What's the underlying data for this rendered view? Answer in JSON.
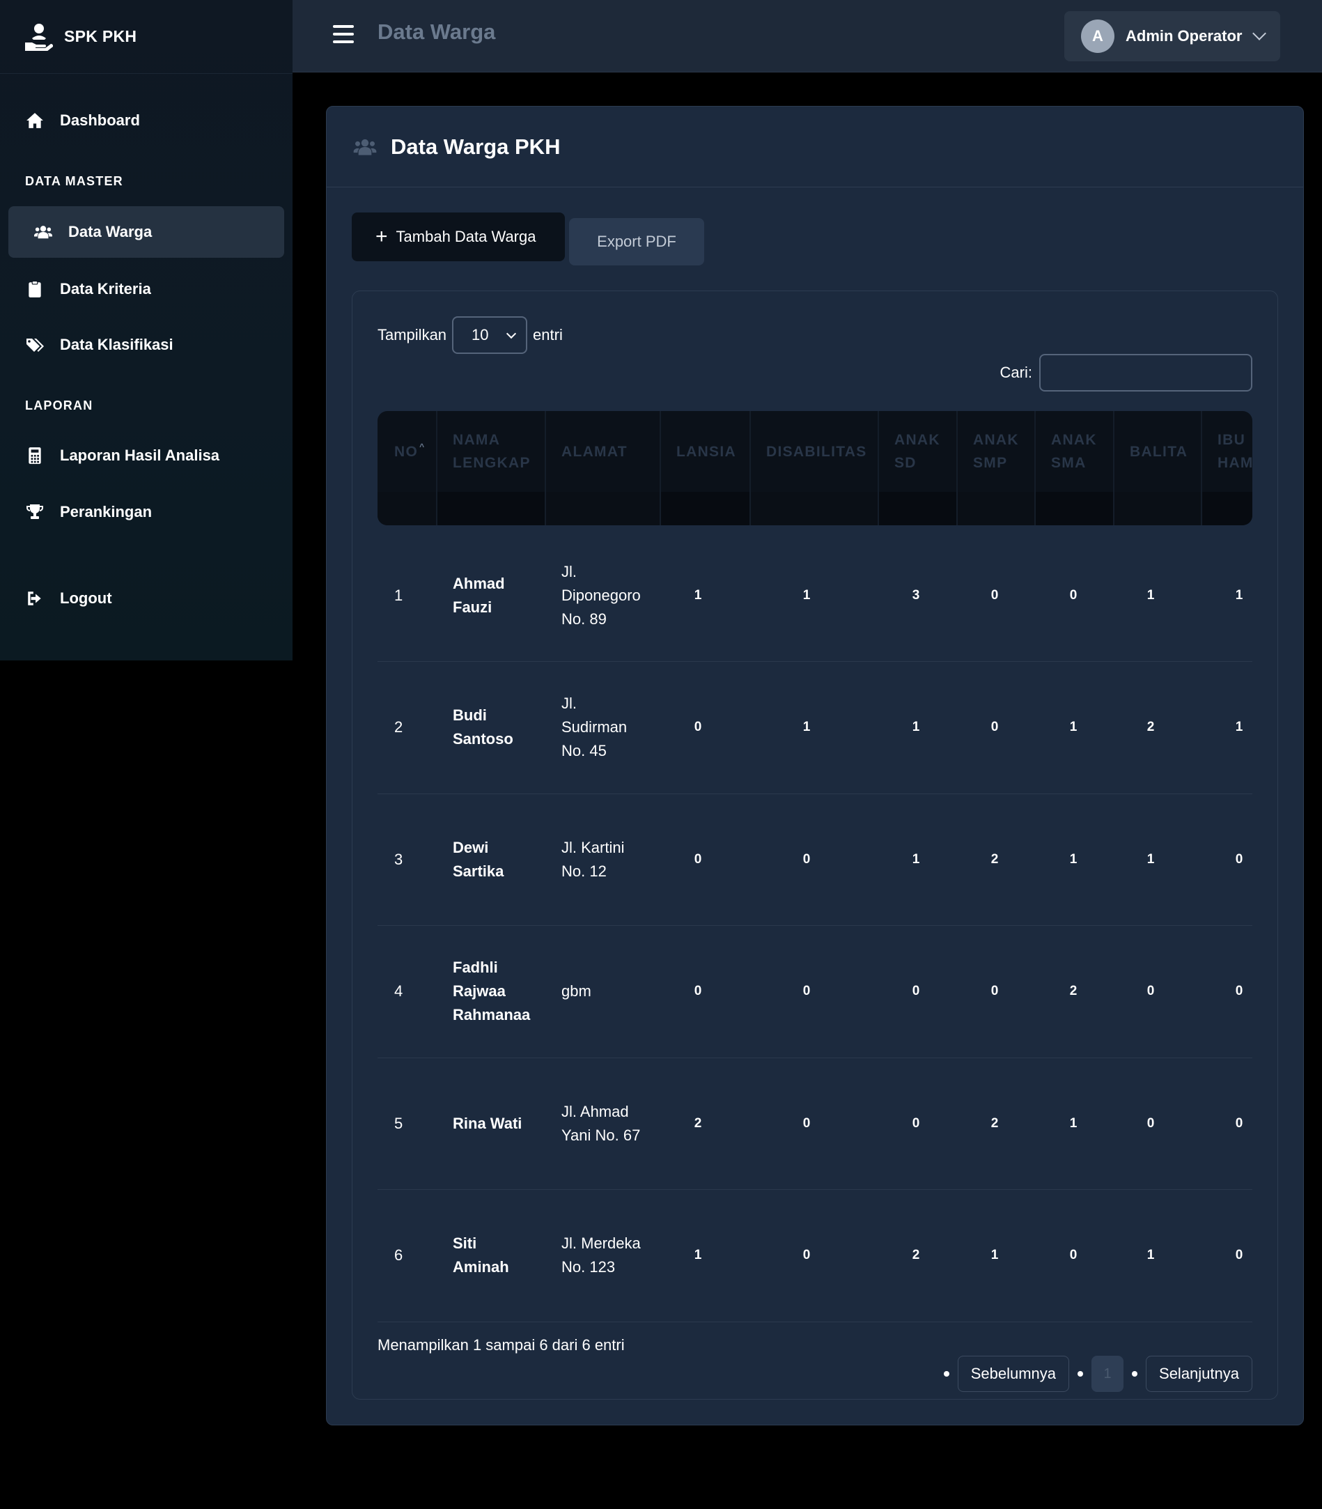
{
  "brand": {
    "name": "SPK PKH"
  },
  "sidebar": {
    "dashboard": "Dashboard",
    "section_master": "DATA MASTER",
    "data_warga": "Data Warga",
    "data_kriteria": "Data Kriteria",
    "data_klasifikasi": "Data Klasifikasi",
    "section_laporan": "LAPORAN",
    "laporan_hasil": "Laporan Hasil Analisa",
    "perankingan": "Perankingan",
    "logout": "Logout"
  },
  "topbar": {
    "title": "Data Warga",
    "user_initial": "A",
    "user_name": "Admin Operator"
  },
  "card": {
    "title": "Data Warga PKH",
    "add_button": "Tambah Data Warga",
    "add_icon": "+",
    "export_button": "Export PDF"
  },
  "table_controls": {
    "show_label": "Tampilkan",
    "page_length": "10",
    "entries_label": "entri",
    "search_label": "Cari:",
    "search_value": ""
  },
  "table": {
    "columns": [
      "NO",
      "NAMA LENGKAP",
      "ALAMAT",
      "LANSIA",
      "DISABILITAS",
      "ANAK SD",
      "ANAK SMP",
      "ANAK SMA",
      "BALITA",
      "IBU HAMIL"
    ],
    "column_lines": [
      [
        "NO"
      ],
      [
        "NAMA",
        "LENGKAP"
      ],
      [
        "ALAMAT"
      ],
      [
        "LANSIA"
      ],
      [
        "DISABILITAS"
      ],
      [
        "ANAK",
        "SD"
      ],
      [
        "ANAK",
        "SMP"
      ],
      [
        "ANAK",
        "SMA"
      ],
      [
        "BALITA"
      ],
      [
        "IBU",
        "HAM"
      ]
    ],
    "sort_indicator": "^",
    "rows": [
      {
        "no": "1",
        "nama": [
          "Ahmad",
          "Fauzi"
        ],
        "alamat": [
          "Jl.",
          "Diponegoro",
          "No. 89"
        ],
        "lansia": "1",
        "disabilitas": "1",
        "anak_sd": "3",
        "anak_smp": "0",
        "anak_sma": "0",
        "balita": "1",
        "ibu_hamil": "1"
      },
      {
        "no": "2",
        "nama": [
          "Budi",
          "Santoso"
        ],
        "alamat": [
          "Jl.",
          "Sudirman",
          "No. 45"
        ],
        "lansia": "0",
        "disabilitas": "1",
        "anak_sd": "1",
        "anak_smp": "0",
        "anak_sma": "1",
        "balita": "2",
        "ibu_hamil": "1"
      },
      {
        "no": "3",
        "nama": [
          "Dewi",
          "Sartika"
        ],
        "alamat": [
          "Jl. Kartini",
          "No. 12"
        ],
        "lansia": "0",
        "disabilitas": "0",
        "anak_sd": "1",
        "anak_smp": "2",
        "anak_sma": "1",
        "balita": "1",
        "ibu_hamil": "0"
      },
      {
        "no": "4",
        "nama": [
          "Fadhli",
          "Rajwaa",
          "Rahmanaa"
        ],
        "alamat": [
          "gbm"
        ],
        "lansia": "0",
        "disabilitas": "0",
        "anak_sd": "0",
        "anak_smp": "0",
        "anak_sma": "2",
        "balita": "0",
        "ibu_hamil": "0"
      },
      {
        "no": "5",
        "nama": [
          "Rina Wati"
        ],
        "alamat": [
          "Jl. Ahmad",
          "Yani No. 67"
        ],
        "lansia": "2",
        "disabilitas": "0",
        "anak_sd": "0",
        "anak_smp": "2",
        "anak_sma": "1",
        "balita": "0",
        "ibu_hamil": "0"
      },
      {
        "no": "6",
        "nama": [
          "Siti",
          "Aminah"
        ],
        "alamat": [
          "Jl. Merdeka",
          "No. 123"
        ],
        "lansia": "1",
        "disabilitas": "0",
        "anak_sd": "2",
        "anak_smp": "1",
        "anak_sma": "0",
        "balita": "1",
        "ibu_hamil": "0"
      }
    ]
  },
  "footer": {
    "info": "Menampilkan 1 sampai 6 dari 6 entri",
    "prev": "Sebelumnya",
    "current_page": "1",
    "next": "Selanjutnya"
  },
  "colors": {
    "sidebar_bg": "#0f1823",
    "topbar_bg": "#1e2939",
    "card_bg": "#1c2a3e",
    "active_item_bg": "#253241",
    "header_text": "#293648"
  },
  "icons": [
    "hand-holding-user-icon",
    "home-icon",
    "users-icon",
    "clipboard-icon",
    "tags-icon",
    "calculator-icon",
    "trophy-icon",
    "logout-icon",
    "hamburger-icon",
    "chevron-down-icon"
  ]
}
